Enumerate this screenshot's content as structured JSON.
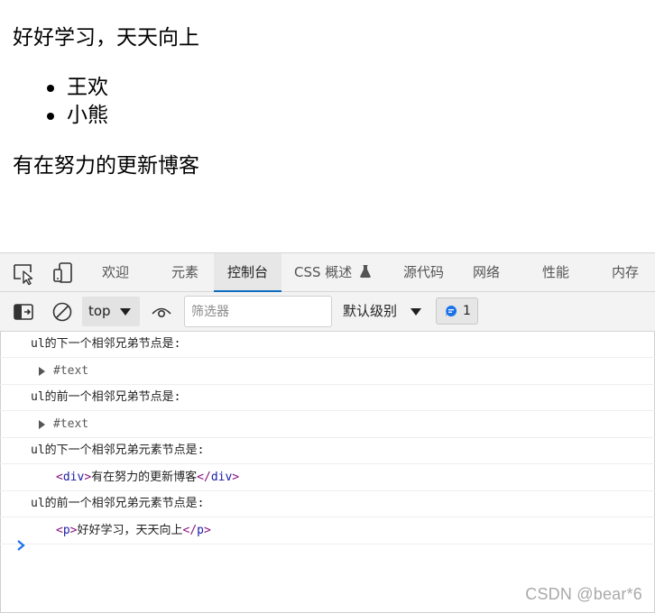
{
  "page": {
    "paragraph": "好好学习，天天向上",
    "list_items": [
      "王欢",
      "小熊"
    ],
    "div_text": "有在努力的更新博客"
  },
  "devtools": {
    "tabs": [
      {
        "label": "欢迎",
        "active": false
      },
      {
        "label": "元素",
        "active": false
      },
      {
        "label": "控制台",
        "active": true
      },
      {
        "label": "CSS 概述",
        "active": false,
        "icon": "flask-icon"
      },
      {
        "label": "源代码",
        "active": false
      },
      {
        "label": "网络",
        "active": false
      },
      {
        "label": "性能",
        "active": false
      },
      {
        "label": "内存",
        "active": false
      }
    ],
    "toolbar": {
      "context": "top",
      "filter_placeholder": "筛选器",
      "level": "默认级别",
      "issues_count": "1"
    },
    "console": [
      {
        "type": "log",
        "text": "ul的下一个相邻兄弟节点是:"
      },
      {
        "type": "object",
        "text": "#text"
      },
      {
        "type": "log",
        "text": "ul的前一个相邻兄弟节点是:"
      },
      {
        "type": "object",
        "text": "#text"
      },
      {
        "type": "log",
        "text": "ul的下一个相邻兄弟元素节点是:"
      },
      {
        "type": "element",
        "tag": "div",
        "open": "<",
        "close_open": "</",
        "gt": ">",
        "content": "有在努力的更新博客"
      },
      {
        "type": "log",
        "text": "ul的前一个相邻兄弟元素节点是:"
      },
      {
        "type": "element",
        "tag": "p",
        "open": "<",
        "close_open": "</",
        "gt": ">",
        "content": "好好学习，天天向上"
      }
    ]
  },
  "colors": {
    "active_tab_underline": "#0f6cbd",
    "tag_bracket": "#881280",
    "tag_name": "#1a1aa6",
    "issues_icon": "#1a73e8"
  },
  "watermark": "CSDN @bear*6"
}
